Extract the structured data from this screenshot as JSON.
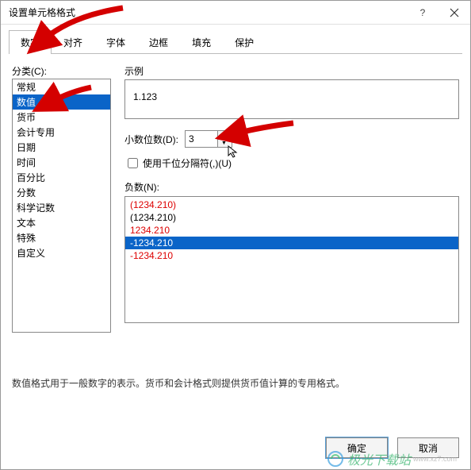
{
  "title": "设置单元格格式",
  "tabs": [
    "数字",
    "对齐",
    "字体",
    "边框",
    "填充",
    "保护"
  ],
  "active_tab": 0,
  "category_label": "分类(C):",
  "categories": [
    "常规",
    "数值",
    "货币",
    "会计专用",
    "日期",
    "时间",
    "百分比",
    "分数",
    "科学记数",
    "文本",
    "特殊",
    "自定义"
  ],
  "selected_category": 1,
  "sample_label": "示例",
  "sample_value": "1.123",
  "decimal_label": "小数位数(D):",
  "decimal_value": "3",
  "thousands_label": "使用千位分隔符(,)(U)",
  "thousands_checked": false,
  "negative_label": "负数(N):",
  "negative_options": [
    {
      "text": "(1234.210)",
      "red": true
    },
    {
      "text": "(1234.210)",
      "red": false
    },
    {
      "text": "1234.210",
      "red": true
    },
    {
      "text": "-1234.210",
      "red": false
    },
    {
      "text": "-1234.210",
      "red": true
    }
  ],
  "selected_negative": 3,
  "description": "数值格式用于一般数字的表示。货币和会计格式则提供货币值计算的专用格式。",
  "ok": "确定",
  "cancel": "取消",
  "watermark": {
    "brand": "极光下载站",
    "url": "www.xz7.com"
  }
}
